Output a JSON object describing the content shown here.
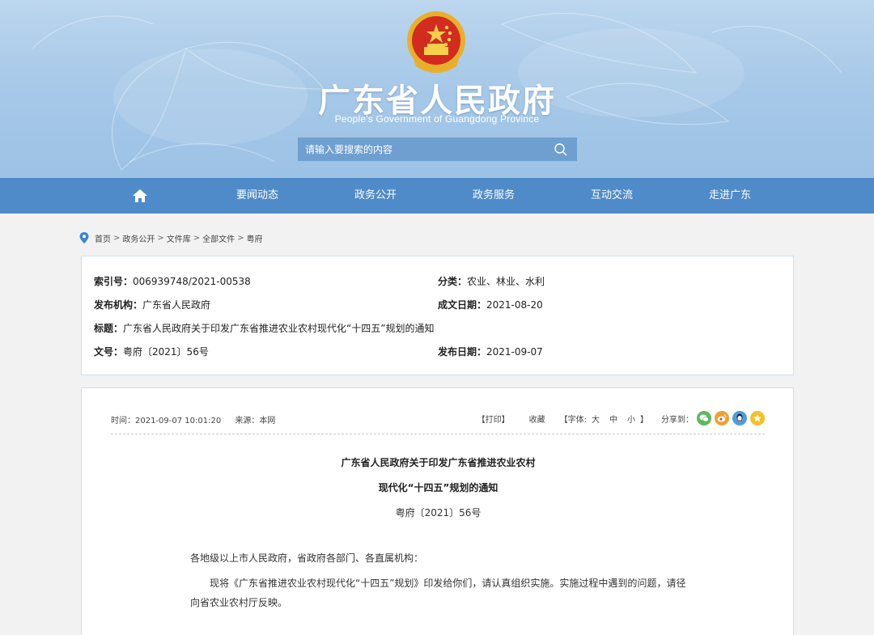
{
  "header": {
    "title": "广东省人民政府",
    "subtitle": "People's Government of Guangdong Province",
    "search_placeholder": "请输入要搜索的内容"
  },
  "nav": {
    "items": [
      "要闻动态",
      "政务公开",
      "政务服务",
      "互动交流",
      "走进广东"
    ]
  },
  "breadcrumb": [
    "首页",
    "政务公开",
    "文件库",
    "全部文件",
    "粤府"
  ],
  "meta": {
    "index_label": "索引号：",
    "index_value": "006939748/2021-00538",
    "category_label": "分类：",
    "category_value": "农业、林业、水利",
    "publisher_label": "发布机构：",
    "publisher_value": "广东省人民政府",
    "created_label": "成文日期：",
    "created_value": "2021-08-20",
    "title_label": "标题：",
    "title_value": "广东省人民政府关于印发广东省推进农业农村现代化“十四五”规划的通知",
    "docno_label": "文号：",
    "docno_value": "粤府〔2021〕56号",
    "published_label": "发布日期：",
    "published_value": "2021-09-07"
  },
  "article": {
    "time": "时间：2021-09-07 10:01:20",
    "source": "来源：本网",
    "print": "【打印】",
    "favorite": "收藏",
    "font_label": "【字体:",
    "font_large": "大",
    "font_medium": "中",
    "font_small": "小",
    "font_end": "】",
    "share": "分享到：",
    "title_line1": "广东省人民政府关于印发广东省推进农业农村",
    "title_line2": "现代化“十四五”规划的通知",
    "doc_no": "粤府〔2021〕56号",
    "salutation": "各地级以上市人民政府，省政府各部门、各直属机构：",
    "body": "现将《广东省推进农业农村现代化“十四五”规划》印发给你们，请认真组织实施。实施过程中遇到的问题，请径向省农业农村厅反映。"
  },
  "colors": {
    "nav": "#4f8bc8",
    "wechat": "#5cb85c",
    "weibo": "#f0a030",
    "qq": "#4a9fe0",
    "qzone": "#f5c02a"
  }
}
